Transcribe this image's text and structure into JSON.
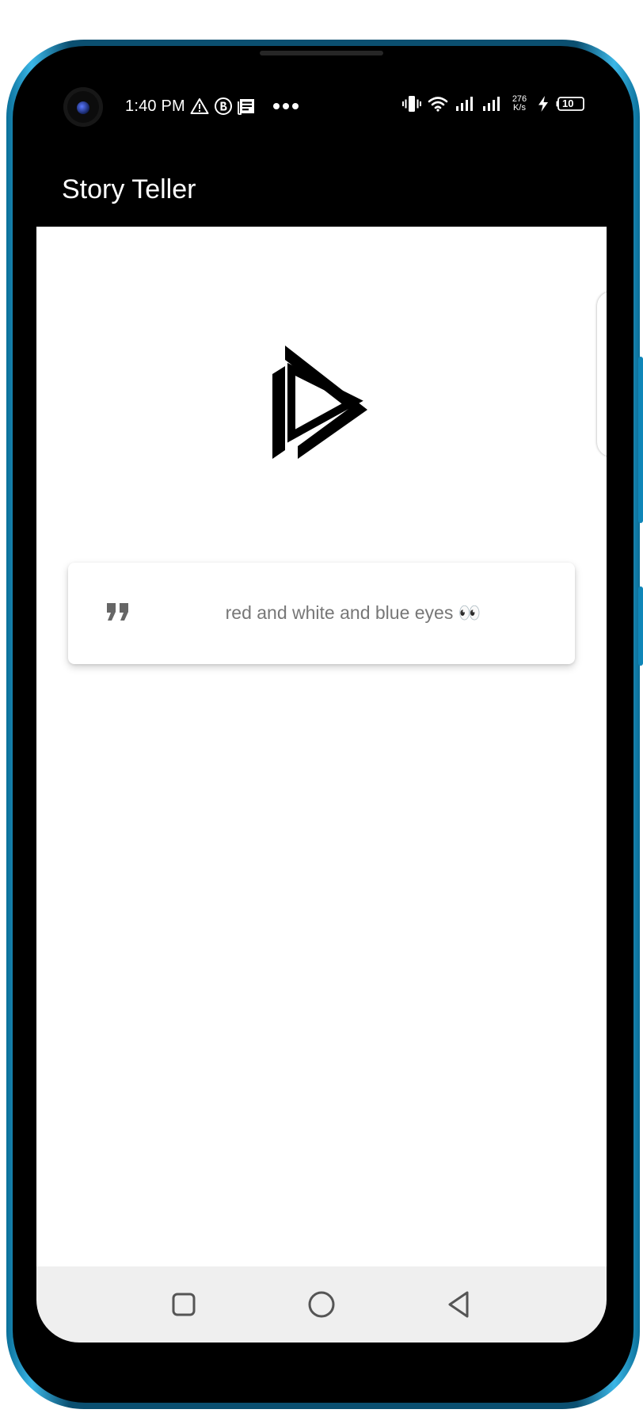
{
  "status_bar": {
    "time": "1:40 PM",
    "left_icons": [
      "warning-icon",
      "whatsapp-business-icon",
      "news-icon",
      "more-dots-icon"
    ],
    "right_icons": [
      "vibrate-icon",
      "wifi-icon",
      "signal-icon",
      "signal-icon-2",
      "network-speed",
      "charging-icon",
      "battery-icon"
    ],
    "network_speed_value": "276",
    "network_speed_unit": "K/s",
    "battery_level": "10"
  },
  "app_bar": {
    "title": "Story Teller"
  },
  "quote_card": {
    "text": "red and white and blue eyes 👀"
  },
  "navigation_bar": {
    "buttons": [
      "recents-icon",
      "home-icon",
      "back-icon"
    ]
  },
  "colors": {
    "app_bar": "#000000",
    "content_bg": "#ffffff",
    "quote_text": "#777777",
    "nav_bar": "#efefef",
    "frame_accent": "#1a9bd0"
  }
}
